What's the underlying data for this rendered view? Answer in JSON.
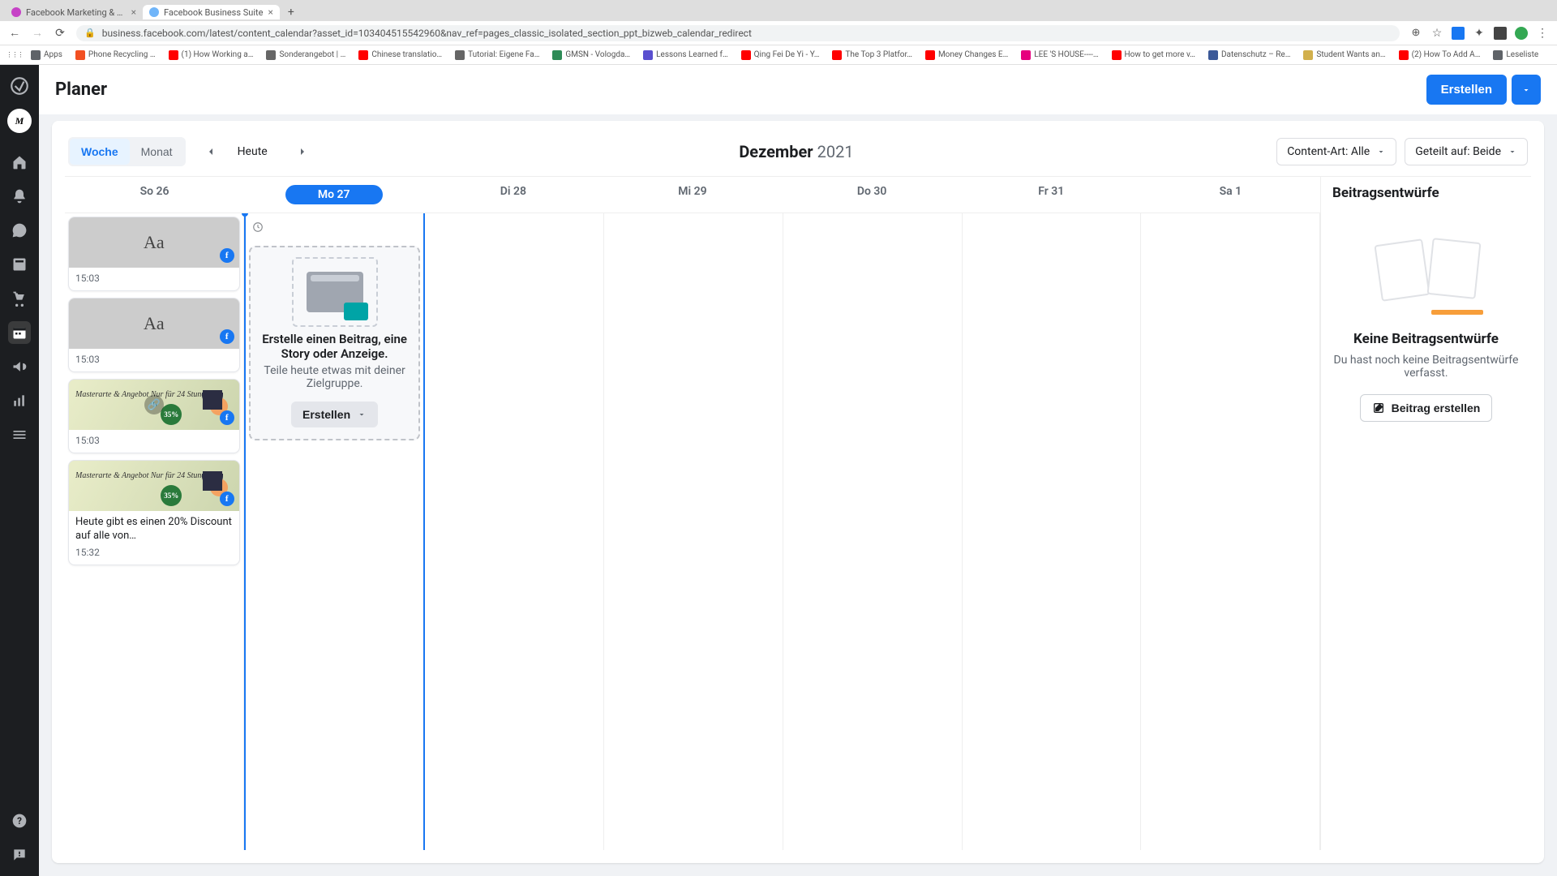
{
  "browser": {
    "tabs": [
      {
        "title": "Facebook Marketing & Werbe…",
        "favicon": "#c642c6"
      },
      {
        "title": "Facebook Business Suite",
        "favicon": "#70b5f9"
      }
    ],
    "url": "business.facebook.com/latest/content_calendar?asset_id=103404515542960&nav_ref=pages_classic_isolated_section_ppt_bizweb_calendar_redirect",
    "bookmarks": [
      {
        "label": "Apps",
        "color": "#5f6368"
      },
      {
        "label": "Phone Recycling …",
        "color": "#f25022"
      },
      {
        "label": "(1) How Working a…",
        "color": "#ff0000"
      },
      {
        "label": "Sonderangebot | …",
        "color": "#666"
      },
      {
        "label": "Chinese translatio…",
        "color": "#ff0000"
      },
      {
        "label": "Tutorial: Eigene Fa…",
        "color": "#666"
      },
      {
        "label": "GMSN - Vologda…",
        "color": "#2e8b57"
      },
      {
        "label": "Lessons Learned f…",
        "color": "#5a4fcf"
      },
      {
        "label": "Qing Fei De Yi - Y…",
        "color": "#ff0000"
      },
      {
        "label": "The Top 3 Platfor…",
        "color": "#ff0000"
      },
      {
        "label": "Money Changes E…",
        "color": "#ff0000"
      },
      {
        "label": "LEE 'S HOUSE----…",
        "color": "#e6007e"
      },
      {
        "label": "How to get more v…",
        "color": "#ff0000"
      },
      {
        "label": "Datenschutz – Re…",
        "color": "#3b5998"
      },
      {
        "label": "Student Wants an…",
        "color": "#d2b04c"
      },
      {
        "label": "(2) How To Add A…",
        "color": "#ff0000"
      },
      {
        "label": "Leseliste",
        "color": "#5f6368"
      }
    ]
  },
  "header": {
    "title": "Planer",
    "create": "Erstellen"
  },
  "toolbar": {
    "woche": "Woche",
    "monat": "Monat",
    "heute": "Heute",
    "month": "Dezember",
    "year": "2021",
    "content_filter": "Content-Art: Alle",
    "share_filter": "Geteilt auf: Beide"
  },
  "days": [
    {
      "label": "So 26",
      "today": false
    },
    {
      "label": "Mo 27",
      "today": true
    },
    {
      "label": "Di 28",
      "today": false
    },
    {
      "label": "Mi 29",
      "today": false
    },
    {
      "label": "Do 30",
      "today": false
    },
    {
      "label": "Fr 31",
      "today": false
    },
    {
      "label": "Sa 1",
      "today": false
    }
  ],
  "posts_col0": [
    {
      "kind": "aa",
      "time": "15:03"
    },
    {
      "kind": "aa",
      "time": "15:03"
    },
    {
      "kind": "img",
      "time": "15:03",
      "discount": "35%",
      "script": "Masterarte & Angebot\nNur für 24 Stunden"
    },
    {
      "kind": "img",
      "time": "15:32",
      "discount": "35%",
      "script": "Masterarte & Angebot\nNur für 24 Stunden",
      "body": "Heute gibt es einen 20% Discount auf alle von…"
    }
  ],
  "create_card": {
    "title": "Erstelle einen Beitrag, eine Story oder Anzeige.",
    "subtitle": "Teile heute etwas mit deiner Zielgruppe.",
    "button": "Erstellen"
  },
  "drafts": {
    "panel_title": "Beitragsentwürfe",
    "heading": "Keine Beitragsentwürfe",
    "sub": "Du hast noch keine Beitragsentwürfe verfasst.",
    "cta": "Beitrag erstellen"
  },
  "icons": {
    "aa": "Aa"
  }
}
